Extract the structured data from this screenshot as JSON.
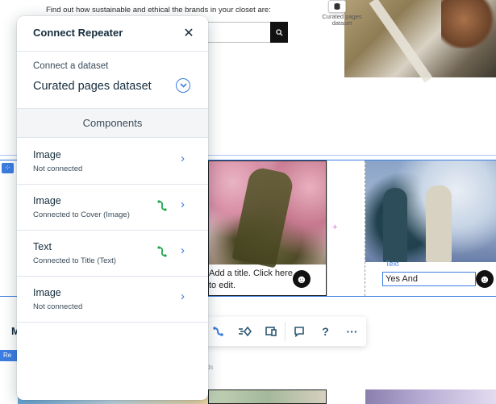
{
  "canvas": {
    "hero_text": "Find out how sustainable and ethical the brands in your closet are:",
    "floating_label": "Curated pages dataset",
    "item_title": "Add a title. Click here to edit.",
    "text_tag": "Text",
    "text_value": "Yes And",
    "left_chip": "M",
    "blue_chip": "Re",
    "faint_text": "ds"
  },
  "toolbar": {
    "icons": [
      "connect-data-icon",
      "animation-icon",
      "layout-icon",
      "comment-icon",
      "help-icon",
      "more-icon"
    ],
    "help_glyph": "?",
    "more_glyph": "···"
  },
  "panel": {
    "title": "Connect Repeater",
    "close_glyph": "✕",
    "dataset_label": "Connect a dataset",
    "dataset_value": "Curated pages dataset",
    "components_title": "Components",
    "components": [
      {
        "name": "Image",
        "status": "Not connected",
        "connected": false
      },
      {
        "name": "Image",
        "status": "Connected to Cover (Image)",
        "connected": true
      },
      {
        "name": "Text",
        "status": "Connected to Title (Text)",
        "connected": true
      },
      {
        "name": "Image",
        "status": "Not connected",
        "connected": false
      }
    ]
  },
  "colors": {
    "accent": "#3b7de0",
    "connected": "#1ea84a",
    "text_dark": "#162d3d"
  }
}
